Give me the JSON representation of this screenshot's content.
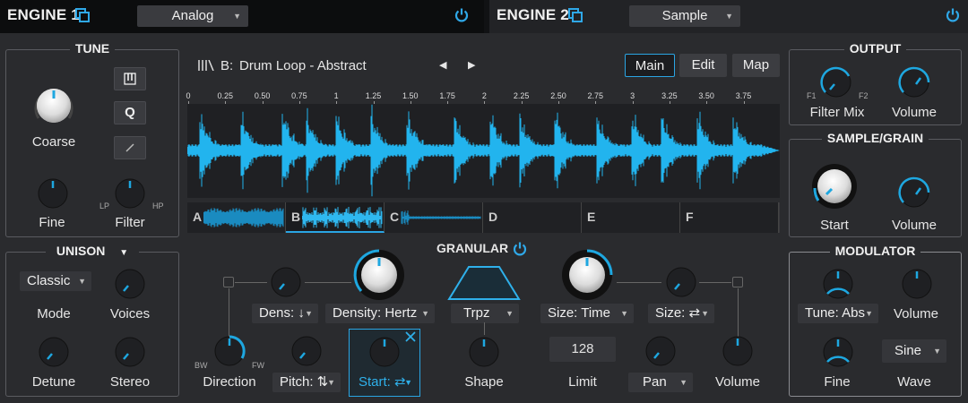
{
  "engine1": {
    "title": "ENGINE 1",
    "type": "Analog"
  },
  "engine2": {
    "title": "ENGINE 2",
    "type": "Sample"
  },
  "tune": {
    "title": "TUNE",
    "coarse": "Coarse",
    "fine": "Fine",
    "filter": "Filter",
    "lp": "LP",
    "hp": "HP",
    "q_button": "Q"
  },
  "unison": {
    "title": "UNISON",
    "mode_value": "Classic",
    "mode": "Mode",
    "voices": "Voices",
    "detune": "Detune",
    "stereo": "Stereo"
  },
  "sample": {
    "slot": "B:",
    "name": "Drum Loop - Abstract",
    "tabs": [
      "Main",
      "Edit",
      "Map"
    ],
    "ticks": [
      "0",
      "0.25",
      "0.50",
      "0.75",
      "1",
      "1.25",
      "1.50",
      "1.75",
      "2",
      "2.25",
      "2.50",
      "2.75",
      "3",
      "3.25",
      "3.50",
      "3.75"
    ],
    "slots": [
      "A",
      "B",
      "C",
      "D",
      "E",
      "F"
    ]
  },
  "granular": {
    "title": "GRANULAR",
    "dens": "Dens: ↓",
    "density": "Density: Hertz",
    "shape_sel": "Trpz",
    "size_time": "Size: Time",
    "size_mod": "Size: ⇄",
    "bw": "BW",
    "fw": "FW",
    "direction": "Direction",
    "pitch": "Pitch: ⇅",
    "start": "Start: ⇄",
    "shape": "Shape",
    "limit_value": "128",
    "limit": "Limit",
    "pan": "Pan",
    "volume": "Volume"
  },
  "output": {
    "title": "OUTPUT",
    "f1": "F1",
    "f2": "F2",
    "filter_mix": "Filter Mix",
    "volume": "Volume"
  },
  "sample_grain": {
    "title": "SAMPLE/GRAIN",
    "start": "Start",
    "volume": "Volume"
  },
  "modulator": {
    "title": "MODULATOR",
    "tune_value": "Tune: Abs",
    "volume": "Volume",
    "fine": "Fine",
    "wave_value": "Sine",
    "wave": "Wave"
  },
  "colors": {
    "accent": "#1ea7e0",
    "wave": "#22b4ee",
    "background": "#2a2b2e"
  }
}
